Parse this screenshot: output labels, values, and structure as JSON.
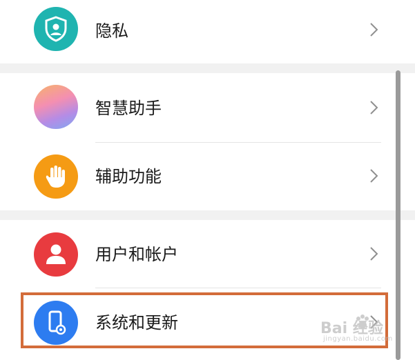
{
  "settings_list": {
    "items": [
      {
        "label": "隐私",
        "icon": "privacy-shield-icon",
        "color": "#1fb4b0"
      },
      {
        "label": "智慧助手",
        "icon": "smart-assistant-icon",
        "color": "#b48ce6"
      },
      {
        "label": "辅助功能",
        "icon": "hand-icon",
        "color": "#f59b14"
      },
      {
        "label": "用户和帐户",
        "icon": "user-icon",
        "color": "#e83b3f"
      },
      {
        "label": "系统和更新",
        "icon": "phone-settings-icon",
        "color": "#2d7cf0"
      }
    ]
  },
  "highlight_color": "#d36c3a",
  "watermark": {
    "logo": "Bai 经验",
    "sub": "jingyan.baidu.com"
  }
}
